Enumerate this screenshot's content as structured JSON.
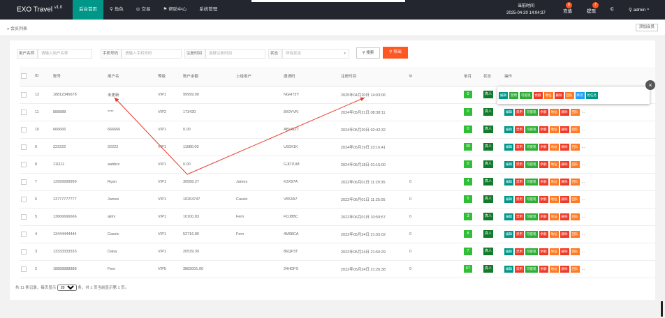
{
  "brand": {
    "name": "EXO Travel",
    "version": "v1.0"
  },
  "nav": [
    {
      "label": "后台首页",
      "icon": "",
      "active": true
    },
    {
      "label": "角色",
      "icon": "user-icon"
    },
    {
      "label": "交易",
      "icon": "globe-icon"
    },
    {
      "label": "帮助中心",
      "icon": "flag-icon"
    },
    {
      "label": "系统管理",
      "icon": ""
    }
  ],
  "topbar": {
    "time_label": "当前时间",
    "time_value": "2025-04-20 14:04:37",
    "recharge": "充值",
    "recharge_badge": "0",
    "withdraw": "提现",
    "withdraw_badge": "7",
    "refresh_icon": "C",
    "user": "admin"
  },
  "breadcrumb": "会员列表",
  "add_button": "添加会员",
  "filters": {
    "username_label": "用户名称",
    "username_placeholder": "请输入用户名称",
    "phone_label": "手机号码",
    "phone_placeholder": "请输入手机号码",
    "regtime_label": "注册时间",
    "regtime_placeholder": "选择注册时间",
    "status_label": "状态",
    "status_placeholder": "所有状态",
    "search": "搜索",
    "export": "导出"
  },
  "table": {
    "headers": [
      "",
      "ID",
      "账号",
      "用户名",
      "等级",
      "账户余额",
      "上级用户",
      "邀请码",
      "注册时间",
      "ip",
      "单月",
      "状态",
      "操作"
    ],
    "rows": [
      {
        "id": "12",
        "account": "18812345678",
        "username": "未更新",
        "level": "VIP1",
        "balance": "99999.00",
        "parent": "",
        "code": "NGH73Y",
        "regtime": "2025年04月20日 14:03:06",
        "ip": "",
        "count": "0",
        "status": "真人"
      },
      {
        "id": "11",
        "account": "888888",
        "username": "****",
        "level": "VIP2",
        "balance": "173420",
        "parent": "",
        "code": "8X9YVN",
        "regtime": "2024年05月21日 08:38:11",
        "ip": "",
        "count": "0",
        "status": "真人"
      },
      {
        "id": "10",
        "account": "666666",
        "username": "666666",
        "level": "VIP1",
        "balance": "0.00",
        "parent": "",
        "code": "ABVGZT",
        "regtime": "2024年05月20日 02:42:32",
        "ip": "",
        "count": "0",
        "status": "真人"
      },
      {
        "id": "9",
        "account": "222222",
        "username": "22222",
        "level": "VIP1",
        "balance": "11686.00",
        "parent": "",
        "code": "U93X1K",
        "regtime": "2024年05月19日 23:16:41",
        "ip": "",
        "count": "20",
        "status": "真人"
      },
      {
        "id": "8",
        "account": "111111",
        "username": "aabbcc",
        "level": "VIP1",
        "balance": "0.00",
        "parent": "",
        "code": "GJD7UM",
        "regtime": "2024年05月18日 01:15:00",
        "ip": "",
        "count": "0",
        "status": "真人"
      },
      {
        "id": "7",
        "account": "13999999999",
        "username": "Ryan",
        "level": "VIP1",
        "balance": "30588.27",
        "parent": "James",
        "code": "K3X97A",
        "regtime": "2022年06月01日 11:29:35",
        "ip": "0",
        "count": "4",
        "status": "真人"
      },
      {
        "id": "6",
        "account": "13777777777",
        "username": "James",
        "level": "VIP1",
        "balance": "10264747",
        "parent": "Cassic",
        "code": "V553A7",
        "regtime": "2022年06月01日 11:25:05",
        "ip": "0",
        "count": "5",
        "status": "真人"
      },
      {
        "id": "5",
        "account": "13666666666",
        "username": "ailini",
        "level": "VIP1",
        "balance": "10100.83",
        "parent": "Fern",
        "code": "FDJ8BC",
        "regtime": "2022年06月01日 10:59:57",
        "ip": "0",
        "count": "3",
        "status": "真人"
      },
      {
        "id": "4",
        "account": "13444444444",
        "username": "Cassic",
        "level": "VIP1",
        "balance": "52716.80",
        "parent": "Fern",
        "code": "4M98CA",
        "regtime": "2022年05月24日 21:55:02",
        "ip": "0",
        "count": "8",
        "status": "真人"
      },
      {
        "id": "3",
        "account": "13333333333",
        "username": "Daisy",
        "level": "VIP1",
        "balance": "20539.39",
        "parent": "",
        "code": "86QP3T",
        "regtime": "2022年05月24日 21:50:29",
        "ip": "0",
        "count": "7",
        "status": "真人"
      },
      {
        "id": "2",
        "account": "18888888888",
        "username": "Fern",
        "level": "VIP5",
        "balance": "3883001.00",
        "parent": "",
        "code": "24HDFS",
        "regtime": "2022年05月24日 21:26:38",
        "ip": "0",
        "count": "67",
        "status": "真人"
      }
    ],
    "ops": [
      "编辑",
      "禁用",
      "可提现",
      "余额",
      "地址",
      "删除",
      "回队"
    ],
    "more": "..."
  },
  "popup_ops": [
    "编辑",
    "禁用",
    "可提现",
    "余额",
    "地址",
    "删除",
    "回队",
    "降流",
    "抢任务"
  ],
  "pager": {
    "prefix": "共 11 条记录，每页显示",
    "page_size": "20",
    "suffix": "条，共 1 页当前显示第 1 页。"
  },
  "colors": {
    "topbar": "#23262e",
    "accent": "#009688",
    "export": "#ff5722",
    "arrow": "#e53b2c"
  }
}
